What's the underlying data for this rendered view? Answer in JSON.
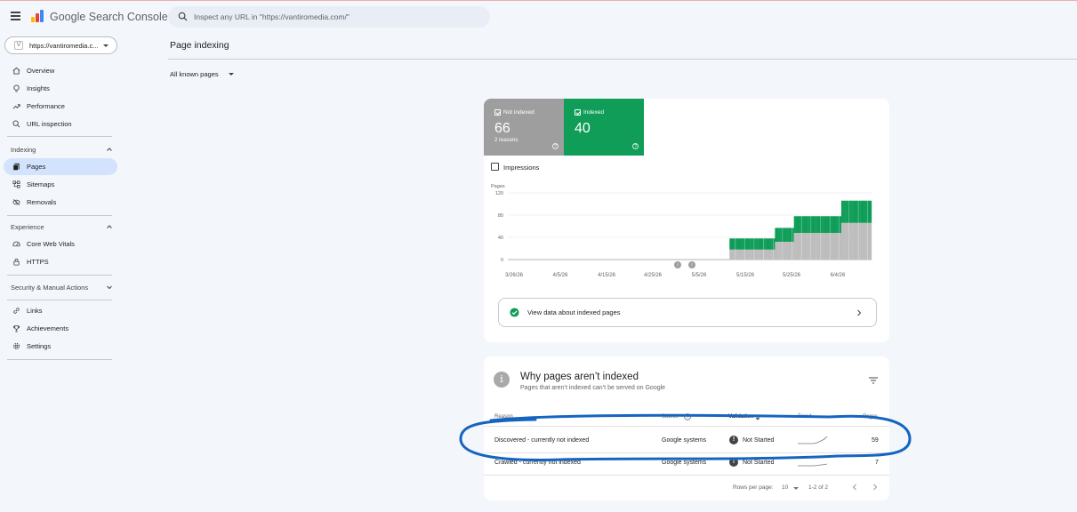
{
  "header": {
    "app_title": "Google Search Console",
    "search_placeholder": "Inspect any URL in \"https://vantiromedia.com/\""
  },
  "property": {
    "label": "https://vantiromedia.c..."
  },
  "sidebar": {
    "top_items": [
      {
        "label": "Overview",
        "icon": "home-icon"
      },
      {
        "label": "Insights",
        "icon": "lightbulb-icon"
      },
      {
        "label": "Performance",
        "icon": "trending-up-icon"
      },
      {
        "label": "URL inspection",
        "icon": "search-icon"
      }
    ],
    "indexing": {
      "title": "Indexing",
      "items": [
        {
          "label": "Pages",
          "icon": "pages-icon",
          "active": true
        },
        {
          "label": "Sitemaps",
          "icon": "sitemap-icon"
        },
        {
          "label": "Removals",
          "icon": "removals-icon"
        }
      ]
    },
    "experience": {
      "title": "Experience",
      "items": [
        {
          "label": "Core Web Vitals",
          "icon": "gauge-icon"
        },
        {
          "label": "HTTPS",
          "icon": "lock-icon"
        }
      ]
    },
    "security": {
      "title": "Security & Manual Actions"
    },
    "bottom_items": [
      {
        "label": "Links",
        "icon": "link-icon"
      },
      {
        "label": "Achievements",
        "icon": "trophy-icon"
      },
      {
        "label": "Settings",
        "icon": "gear-icon"
      }
    ]
  },
  "main": {
    "page_title": "Page indexing",
    "filter_label": "All known pages"
  },
  "summary": {
    "not_indexed": {
      "label": "Not indexed",
      "value": "66",
      "sub": "2 reasons",
      "color": "#9e9e9e"
    },
    "indexed": {
      "label": "Indexed",
      "value": "40",
      "color": "#0f9d58"
    },
    "impressions_label": "Impressions",
    "view_link": "View data about indexed pages"
  },
  "chart_data": {
    "type": "bar",
    "stacked": true,
    "ylabel": "Pages",
    "ylim": [
      0,
      120
    ],
    "yticks": [
      0,
      40,
      80,
      120
    ],
    "xtick_labels": [
      "3/26/26",
      "4/5/26",
      "4/15/26",
      "4/25/26",
      "5/5/26",
      "5/15/26",
      "5/25/26",
      "6/4/26"
    ],
    "annotation_markers": [
      2,
      2
    ],
    "series": [
      {
        "name": "Not indexed",
        "color": "#bdbdbd",
        "values": [
          0,
          0,
          0,
          0,
          0,
          0,
          0,
          0,
          0,
          0,
          0,
          0,
          0,
          0,
          0,
          0,
          0,
          0,
          0,
          0,
          0,
          0,
          0,
          0,
          0,
          0,
          0,
          0,
          0,
          0,
          0,
          0,
          0,
          0,
          0,
          0,
          0,
          0,
          0,
          0,
          0,
          0,
          0,
          0,
          0,
          0,
          0,
          0,
          0,
          0,
          0,
          0,
          0,
          0,
          0,
          0,
          0,
          0,
          0,
          0,
          0,
          0,
          0,
          0,
          0,
          0,
          0,
          0,
          0,
          0,
          0,
          0,
          0,
          0,
          0,
          0,
          0,
          0,
          0,
          0,
          0,
          0,
          0,
          0,
          0,
          0,
          0,
          0,
          0,
          0,
          0,
          0,
          0,
          0,
          0,
          0,
          0,
          0,
          0,
          0,
          0,
          0,
          0,
          0,
          0,
          0,
          0,
          0,
          0,
          0,
          0,
          0,
          0,
          0,
          0,
          0,
          0,
          18,
          18,
          18,
          18,
          18,
          18,
          18,
          18,
          18,
          18,
          18,
          18,
          18,
          18,
          18,
          18,
          18,
          18,
          18,
          18,
          18,
          18,
          18,
          18,
          32,
          32,
          32,
          32,
          32,
          32,
          32,
          32,
          32,
          32,
          48,
          48,
          48,
          48,
          48,
          48,
          48,
          48,
          48,
          48,
          48,
          48,
          48,
          48,
          48,
          48,
          48,
          48,
          48,
          48,
          48,
          48,
          48,
          48,
          48,
          66,
          66,
          66,
          66,
          66,
          66,
          66,
          66,
          66,
          66,
          66,
          66,
          66,
          66,
          66,
          66
        ]
      },
      {
        "name": "Indexed",
        "color": "#0f9d58",
        "values": [
          0,
          0,
          0,
          0,
          0,
          0,
          0,
          0,
          0,
          0,
          0,
          0,
          0,
          0,
          0,
          0,
          0,
          0,
          0,
          0,
          0,
          0,
          0,
          0,
          0,
          0,
          0,
          0,
          0,
          0,
          0,
          0,
          0,
          0,
          0,
          0,
          0,
          0,
          0,
          0,
          0,
          0,
          0,
          0,
          0,
          0,
          0,
          0,
          0,
          0,
          0,
          0,
          0,
          0,
          0,
          0,
          0,
          0,
          0,
          0,
          0,
          0,
          0,
          0,
          0,
          0,
          0,
          0,
          0,
          0,
          0,
          0,
          0,
          0,
          0,
          0,
          0,
          0,
          0,
          0,
          0,
          0,
          0,
          0,
          0,
          0,
          0,
          0,
          0,
          0,
          0,
          0,
          0,
          0,
          0,
          0,
          0,
          0,
          0,
          0,
          0,
          0,
          0,
          0,
          0,
          0,
          0,
          0,
          0,
          0,
          0,
          0,
          0,
          0,
          0,
          0,
          0,
          20,
          20,
          20,
          20,
          20,
          20,
          20,
          20,
          20,
          20,
          20,
          20,
          20,
          20,
          20,
          20,
          20,
          20,
          20,
          20,
          20,
          20,
          20,
          20,
          25,
          25,
          25,
          25,
          25,
          25,
          25,
          25,
          25,
          25,
          30,
          30,
          30,
          30,
          30,
          30,
          30,
          30,
          30,
          30,
          30,
          30,
          30,
          30,
          30,
          30,
          30,
          30,
          30,
          30,
          30,
          30,
          30,
          30,
          30,
          40,
          40,
          40,
          40,
          40,
          40,
          40,
          40,
          40,
          40,
          40,
          40,
          40,
          40,
          40,
          40
        ]
      }
    ]
  },
  "reasons": {
    "title": "Why pages aren’t indexed",
    "subtitle": "Pages that aren’t indexed can’t be served on Google",
    "columns": {
      "reason": "Reason",
      "source": "Source",
      "validation": "Validation",
      "trend": "Trend",
      "pages": "Pages"
    },
    "rows": [
      {
        "reason": "Discovered - currently not indexed",
        "source": "Google systems",
        "validation": "Not Started",
        "pages": "59"
      },
      {
        "reason": "Crawled - currently not indexed",
        "source": "Google systems",
        "validation": "Not Started",
        "pages": "7"
      }
    ],
    "pagination": {
      "rows_per_page_label": "Rows per page:",
      "rows_per_page": "10",
      "range": "1-2 of 2"
    },
    "annotation_color": "#1565c0"
  }
}
